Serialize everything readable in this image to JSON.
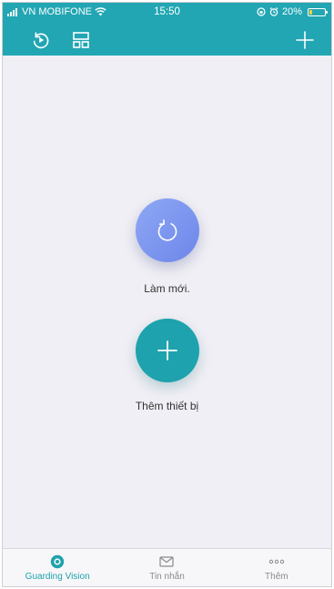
{
  "status_bar": {
    "carrier": "VN MOBIFONE",
    "time": "15:50",
    "battery_percent": "20%",
    "battery_level": 0.2
  },
  "header": {
    "left_icons": [
      "history-icon",
      "layout-icon"
    ],
    "right_icon": "plus-icon"
  },
  "main": {
    "refresh_label": "Làm mới.",
    "add_device_label": "Thêm thiết bị"
  },
  "tabbar": {
    "tabs": [
      {
        "label": "Guarding Vision",
        "icon": "camera-icon",
        "active": true
      },
      {
        "label": "Tin nhắn",
        "icon": "mail-icon",
        "active": false
      },
      {
        "label": "Thêm",
        "icon": "more-icon",
        "active": false
      }
    ]
  },
  "colors": {
    "header_bg": "#22a6b3",
    "accent": "#1ea2ad",
    "refresh_button": "#7b94ee",
    "background": "#f0eff5",
    "battery_fill": "#f2d33a"
  }
}
